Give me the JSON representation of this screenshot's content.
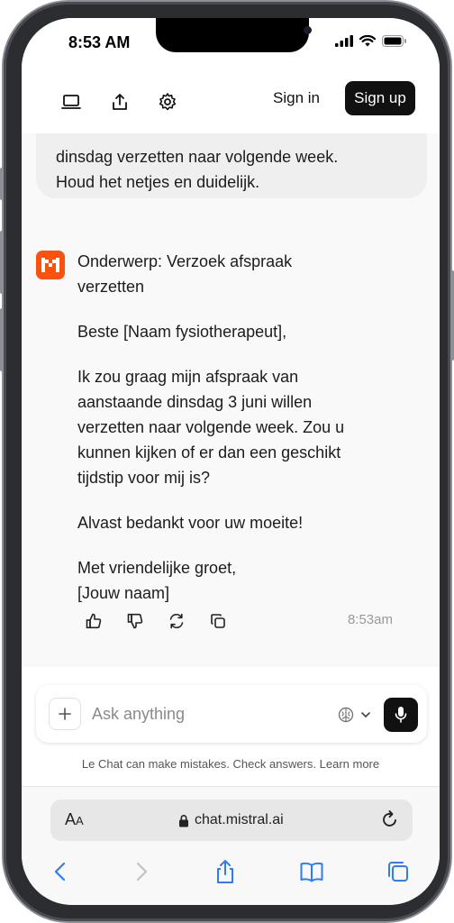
{
  "status_bar": {
    "time": "8:53 AM"
  },
  "header": {
    "sign_in": "Sign in",
    "sign_up": "Sign up"
  },
  "user_message": {
    "lines": [
      "dinsdag verzetten naar volgende week.",
      "Houd het netjes en duidelijk."
    ]
  },
  "reply": {
    "subject": [
      "Onderwerp: Verzoek afspraak",
      "verzetten"
    ],
    "greeting": "Beste [Naam fysiotherapeut],",
    "body": [
      "Ik zou graag mijn afspraak van",
      "aanstaande dinsdag 3 juni willen",
      "verzetten naar volgende week. Zou u",
      "kunnen kijken of er dan een geschikt",
      "tijdstip voor mij is?"
    ],
    "thanks": "Alvast bedankt voor uw moeite!",
    "closing": [
      "Met vriendelijke groet,",
      "[Jouw naam]"
    ],
    "time": "8:53am"
  },
  "composer": {
    "placeholder": "Ask anything"
  },
  "disclaimer": {
    "text": "Le Chat can make mistakes. Check answers.",
    "link": "Learn more"
  },
  "browser": {
    "aa_big": "A",
    "aa_small": "A",
    "url": "chat.mistral.ai"
  },
  "colors": {
    "brand": "#fa520f",
    "primary_button": "#111111",
    "chat_bg": "#f9f9f9"
  }
}
